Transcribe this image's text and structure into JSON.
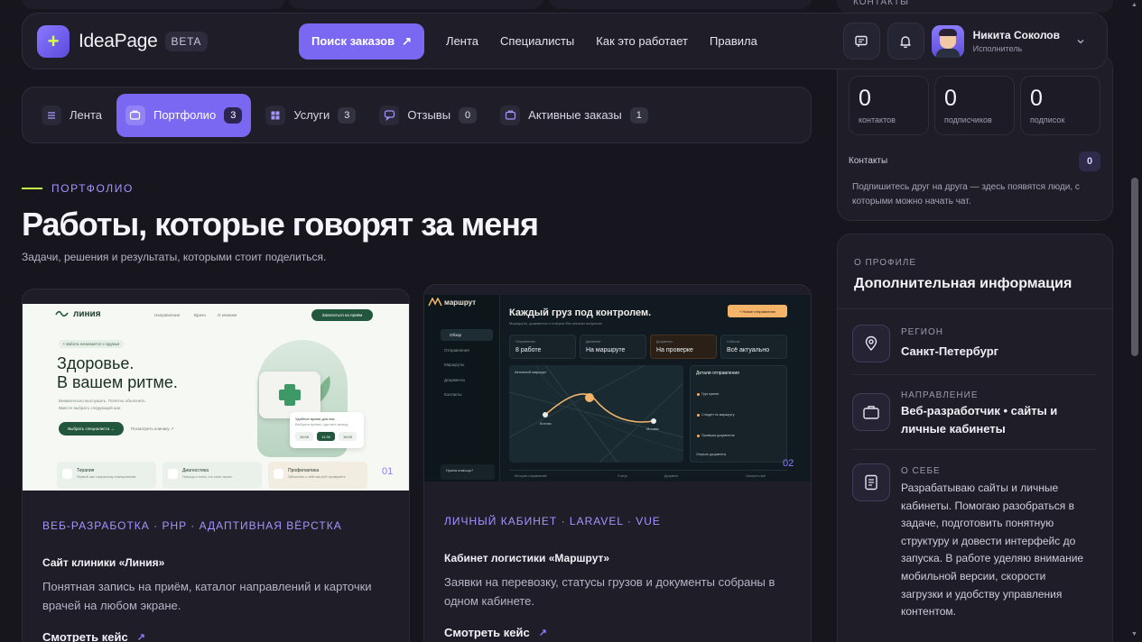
{
  "header": {
    "logo_mark": "+",
    "logo_text": "IdeaPage",
    "beta": "BETA",
    "cta_label": "Поиск заказов",
    "cta_arrow": "↗",
    "nav": [
      "Лента",
      "Специалисты",
      "Как это работает",
      "Правила"
    ],
    "user_name": "Никита Соколов",
    "user_role": "Исполнитель"
  },
  "top_strip": {
    "contacts_label": "КОНТАКТЫ"
  },
  "tabs": [
    {
      "label": "Лента",
      "count": ""
    },
    {
      "label": "Портфолио",
      "count": "3"
    },
    {
      "label": "Услуги",
      "count": "3"
    },
    {
      "label": "Отзывы",
      "count": "0"
    },
    {
      "label": "Активные заказы",
      "count": "1"
    }
  ],
  "section": {
    "eyebrow": "ПОРТФОЛИО",
    "title": "Работы, которые говорят за меня",
    "subtitle": "Задачи, решения и результаты, которыми стоит поделиться."
  },
  "cards": [
    {
      "number": "01",
      "tag": "ВЕБ-РАЗРАБОТКА · PHP · АДАПТИВНАЯ ВЁРСТКА",
      "title": "Сайт клиники «Линия»",
      "desc": "Понятная запись на приём, каталог направлений и карточки врачей на любом экране.",
      "link": "Смотреть кейс",
      "preview": {
        "logo": "линия",
        "nav": [
          "Направления",
          "Врачи",
          "О клинике"
        ],
        "button": "Записаться на приём",
        "pill": "• Забота начинается с вдумья",
        "headline_1": "Здоровье.",
        "headline_2": "В вашем ритме.",
        "text": "Внимательно выслушать. Понятно объяснить. Вместе выбрать следующий шаг.",
        "primary": "Выбрать специалиста  →",
        "secondary": "Посмотреть клинику ↗",
        "popup_title": "Удобное время для вас",
        "popup_sub": "Выбрать время, сделать вывод",
        "slots": [
          "10:00",
          "11:30",
          "15:00"
        ],
        "features": [
          {
            "title": "Терапия",
            "sub": "Первый шаг к взрослому планированию"
          },
          {
            "title": "Диагностика",
            "sub": "Помощь и точно, что стоит искать"
          },
          {
            "title": "Профилактика",
            "sub": "Заботьтесь о себе как учёт-проверяете"
          }
        ]
      }
    },
    {
      "number": "02",
      "tag": "ЛИЧНЫЙ КАБИНЕТ · LARAVEL · VUE",
      "title": "Кабинет логистики «Маршрут»",
      "desc": "Заявки на перевозку, статусы грузов и документы собраны в одном кабинете.",
      "link": "Смотреть кейс",
      "preview": {
        "logo": "маршрут",
        "menu": [
          "Обзор",
          "Отправления",
          "Маршруты",
          "Документы",
          "Контакты"
        ],
        "headline": "Каждый груз под контролем.",
        "sub": "Маршруты, документы и статусы без лишних вопросов.",
        "cta": "+ Новое отправление",
        "stats": [
          {
            "label": "Отправления",
            "value": "8 работе"
          },
          {
            "label": "Движение",
            "value": "На маршруте"
          },
          {
            "label": "Документы",
            "value": "На проверке"
          },
          {
            "label": "События",
            "value": "Всё актуально"
          }
        ],
        "map_label": "Активный маршрут",
        "city_a": "Котлас",
        "city_b": "Москва",
        "details_title": "Детали отправления",
        "details_items": [
          "Груз принят",
          "Следует по маршруту",
          "Проверка документов"
        ],
        "details_link": "Открыть документы",
        "table_head": [
          "История отправлений",
          "Статус",
          "Документ",
          "Смотреть всё"
        ],
        "side_note": "Нужна помощь?"
      }
    }
  ],
  "right": {
    "stats": [
      {
        "value": "0",
        "label": "контактов"
      },
      {
        "value": "0",
        "label": "подписчиков"
      },
      {
        "value": "0",
        "label": "подписок"
      }
    ],
    "contacts_label": "Контакты",
    "contacts_count": "0",
    "contacts_hint": "Подпишитесь друг на друга — здесь появятся люди, с которыми можно начать чат.",
    "profile_eyebrow": "О ПРОФИЛЕ",
    "profile_title": "Дополнительная информация",
    "region_label": "РЕГИОН",
    "region_value": "Санкт-Петербург",
    "direction_label": "НАПРАВЛЕНИЕ",
    "direction_value": "Веб-разработчик • сайты и личные кабинеты",
    "about_label": "О СЕБЕ",
    "about_value": "Разрабатываю сайты и личные кабинеты. Помогаю разобраться в задаче, подготовить понятную структуру и довести интерфейс до запуска. В работе уделяю внимание мобильной версии, скорости загрузки и удобству управления контентом."
  }
}
